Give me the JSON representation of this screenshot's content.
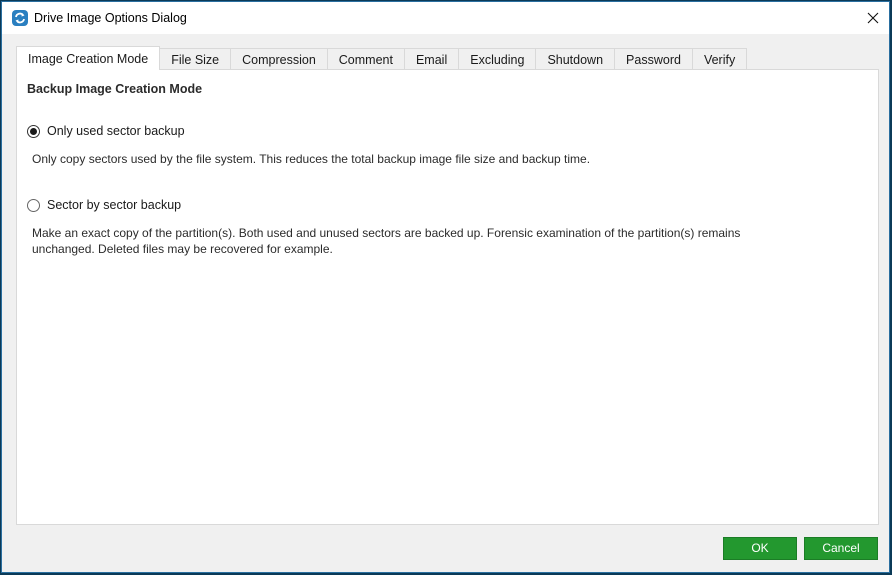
{
  "window": {
    "title": "Drive Image Options Dialog",
    "icon": "app-sync-icon",
    "close_icon": "close-icon"
  },
  "tabs": [
    {
      "label": "Image Creation Mode",
      "active": true
    },
    {
      "label": "File Size",
      "active": false
    },
    {
      "label": "Compression",
      "active": false
    },
    {
      "label": "Comment",
      "active": false
    },
    {
      "label": "Email",
      "active": false
    },
    {
      "label": "Excluding",
      "active": false
    },
    {
      "label": "Shutdown",
      "active": false
    },
    {
      "label": "Password",
      "active": false
    },
    {
      "label": "Verify",
      "active": false
    }
  ],
  "panel": {
    "section_title": "Backup Image Creation Mode",
    "options": [
      {
        "label": "Only used sector backup",
        "selected": true,
        "description": "Only copy sectors used by the file system. This reduces the total backup image file size and backup time."
      },
      {
        "label": "Sector by sector backup",
        "selected": false,
        "description_lines": [
          "Make an exact copy of the partition(s). Both used and unused sectors are backed up. Forensic examination of the partition(s) remains",
          "unchanged. Deleted files may be recovered for example."
        ]
      }
    ]
  },
  "buttons": {
    "ok": "OK",
    "cancel": "Cancel"
  },
  "colors": {
    "button_green": "#23982f",
    "window_border": "#2a6fa0",
    "icon_blue": "#2a7fc0"
  }
}
